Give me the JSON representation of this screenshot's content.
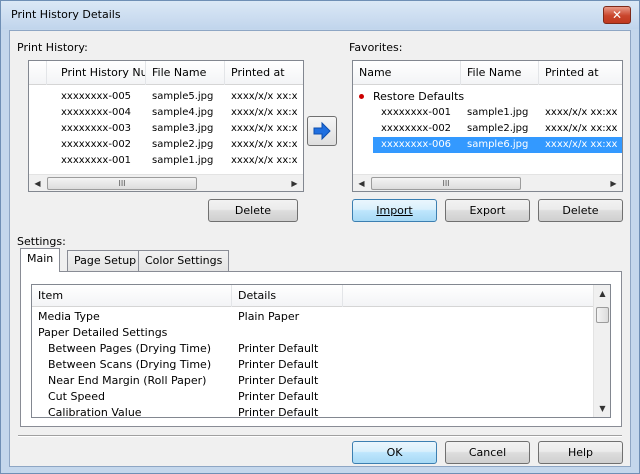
{
  "window": {
    "title": "Print History Details"
  },
  "print_history": {
    "label": "Print History:",
    "columns": [
      "Print History Nu...",
      "File Name",
      "Printed at"
    ],
    "rows": [
      {
        "number": "xxxxxxxx-005",
        "file": "sample5.jpg",
        "printed": "xxxx/x/x xx:x"
      },
      {
        "number": "xxxxxxxx-004",
        "file": "sample4.jpg",
        "printed": "xxxx/x/x xx:x"
      },
      {
        "number": "xxxxxxxx-003",
        "file": "sample3.jpg",
        "printed": "xxxx/x/x xx:x"
      },
      {
        "number": "xxxxxxxx-002",
        "file": "sample2.jpg",
        "printed": "xxxx/x/x xx:x"
      },
      {
        "number": "xxxxxxxx-001",
        "file": "sample1.jpg",
        "printed": "xxxx/x/x xx:x"
      }
    ],
    "scroll_thumb": "III",
    "delete_label": "Delete"
  },
  "favorites": {
    "label": "Favorites:",
    "columns": [
      "Name",
      "File Name",
      "Printed at"
    ],
    "restore_label": "Restore Defaults",
    "restore_bullet_color": "#cc0000",
    "rows": [
      {
        "name": "xxxxxxxx-001",
        "file": "sample1.jpg",
        "printed": "xxxx/x/x xx:xx",
        "selected": false
      },
      {
        "name": "xxxxxxxx-002",
        "file": "sample2.jpg",
        "printed": "xxxx/x/x xx:xx",
        "selected": false
      },
      {
        "name": "xxxxxxxx-006",
        "file": "sample6.jpg",
        "printed": "xxxx/x/x xx:xx",
        "selected": true
      }
    ],
    "scroll_thumb": "III",
    "import_label": "Import",
    "export_label": "Export",
    "delete_label": "Delete"
  },
  "settings": {
    "label": "Settings:",
    "tabs": [
      {
        "label": "Main",
        "active": true
      },
      {
        "label": "Page Setup",
        "active": false
      },
      {
        "label": "Color Settings",
        "active": false
      }
    ],
    "columns": [
      "Item",
      "Details"
    ],
    "rows": [
      {
        "item": "Media Type",
        "details": "Plain Paper",
        "indent": false
      },
      {
        "item": "Paper Detailed Settings",
        "details": "",
        "indent": false
      },
      {
        "item": "Between Pages (Drying Time)",
        "details": "Printer Default",
        "indent": true
      },
      {
        "item": "Between Scans (Drying Time)",
        "details": "Printer Default",
        "indent": true
      },
      {
        "item": "Near End Margin (Roll Paper)",
        "details": "Printer Default",
        "indent": true
      },
      {
        "item": "Cut Speed",
        "details": "Printer Default",
        "indent": true
      },
      {
        "item": "Calibration Value",
        "details": "Printer Default",
        "indent": true
      }
    ]
  },
  "footer": {
    "ok_label": "OK",
    "cancel_label": "Cancel",
    "help_label": "Help"
  },
  "colors": {
    "selection": "#3399ff",
    "accent_arrow": "#1f6fe0",
    "close_button": "#c9452c"
  }
}
